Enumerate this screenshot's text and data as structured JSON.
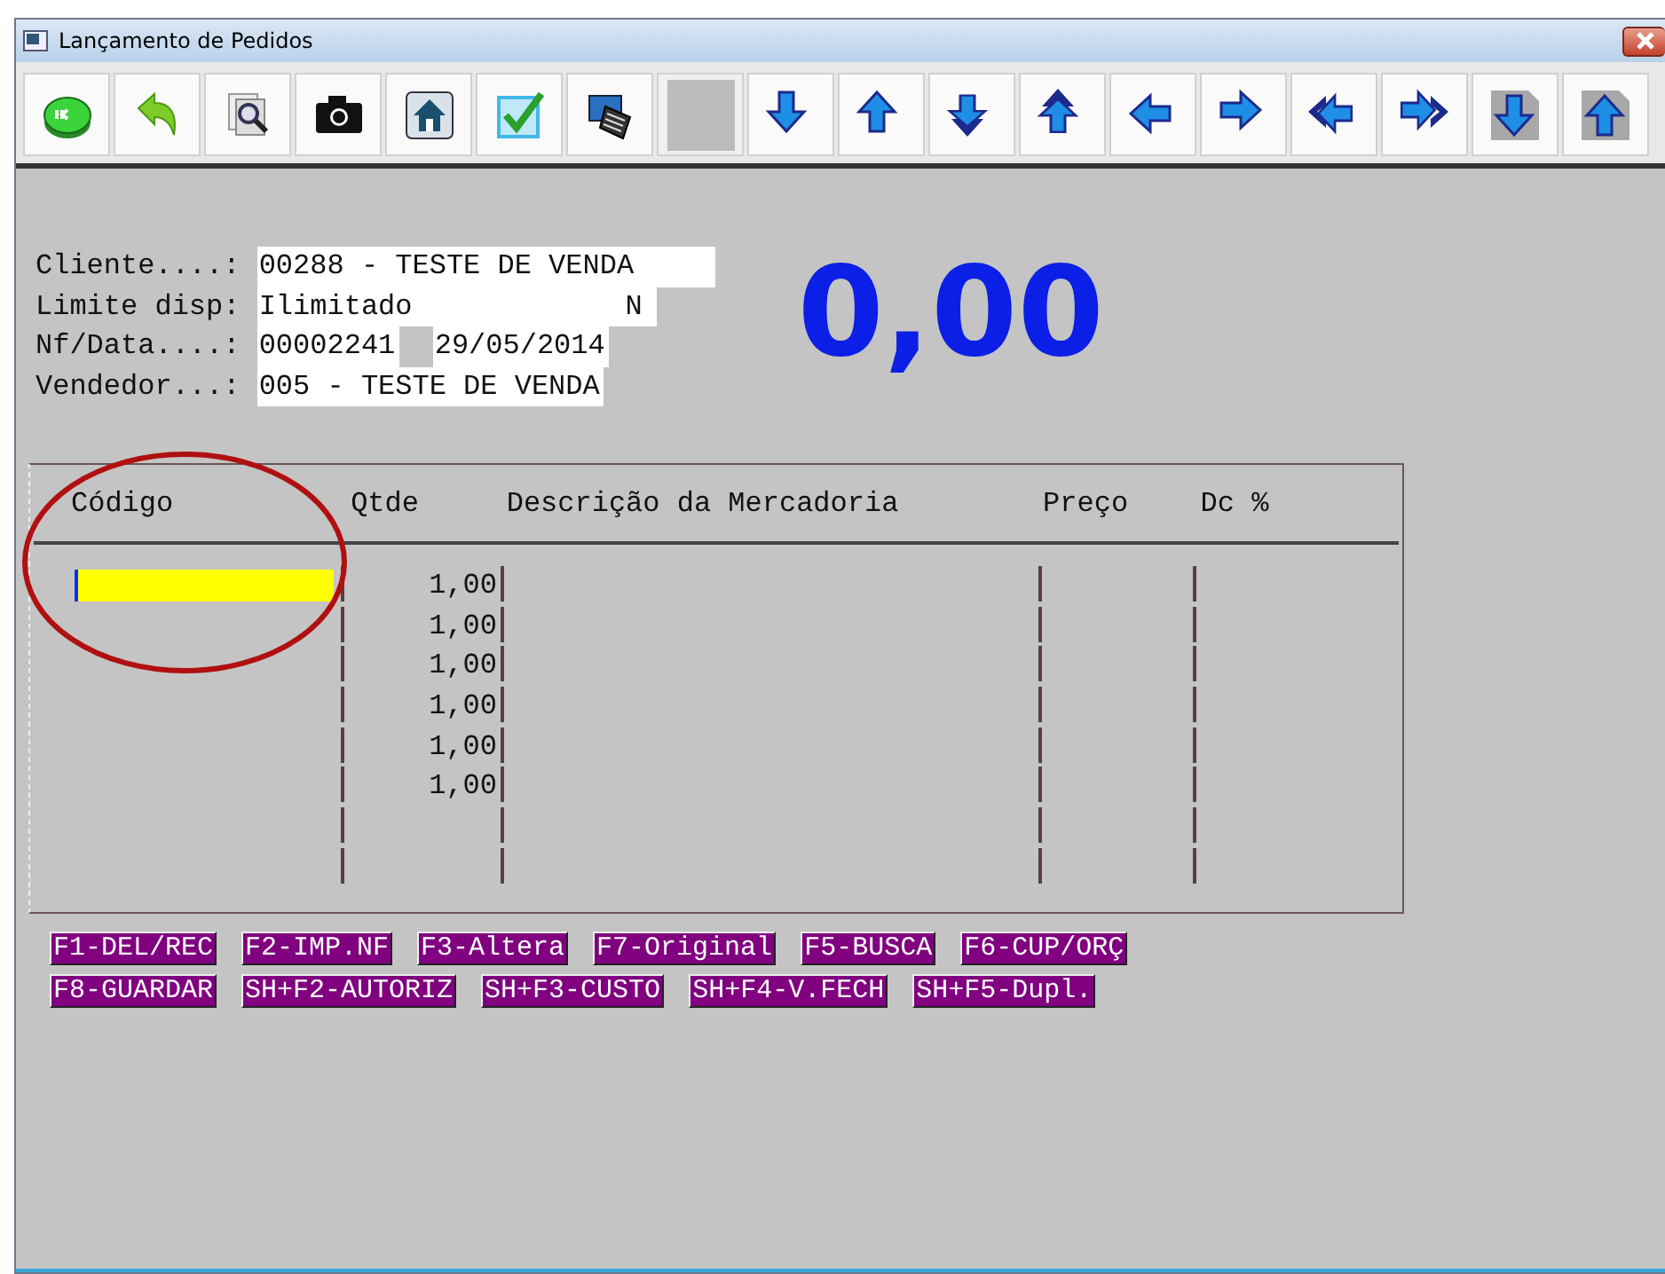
{
  "window": {
    "title": "Lançamento de Pedidos"
  },
  "toolbar": [
    {
      "kind": "ok"
    },
    {
      "kind": "undo"
    },
    {
      "kind": "search-docs"
    },
    {
      "kind": "camera"
    },
    {
      "kind": "home"
    },
    {
      "kind": "check"
    },
    {
      "kind": "tablet"
    },
    {
      "kind": "blank"
    },
    {
      "kind": "down"
    },
    {
      "kind": "up"
    },
    {
      "kind": "double-down"
    },
    {
      "kind": "double-up"
    },
    {
      "kind": "left"
    },
    {
      "kind": "right"
    },
    {
      "kind": "double-left"
    },
    {
      "kind": "double-right"
    },
    {
      "kind": "doc-down"
    },
    {
      "kind": "doc-up"
    }
  ],
  "fields": [
    {
      "label": "Cliente....:",
      "values": [
        "00288 - TESTE DE VENDA"
      ]
    },
    {
      "label": "Limite disp:",
      "values": [
        "Ilimitado",
        "N"
      ]
    },
    {
      "label": "Nf/Data....:",
      "values": [
        "00002241",
        "29/05/2014"
      ]
    },
    {
      "label": "Vendedor...:",
      "values": [
        "005 - TESTE DE VENDA"
      ]
    }
  ],
  "total": "0,00",
  "table": {
    "columns": [
      "Código",
      "Qtde",
      "Descrição da Mercadoria",
      "Preço",
      "Dc %"
    ],
    "rows": [
      {
        "active": true,
        "qtde": "1,00"
      },
      {
        "active": false,
        "qtde": "1,00"
      },
      {
        "active": false,
        "qtde": "1,00"
      },
      {
        "active": false,
        "qtde": "1,00"
      },
      {
        "active": false,
        "qtde": "1,00"
      },
      {
        "active": false,
        "qtde": "1,00"
      },
      {
        "active": false
      },
      {
        "active": false
      }
    ]
  },
  "function_keys": [
    [
      "F1-DEL/REC",
      "F2-IMP.NF",
      "F3-Altera",
      "F7-Original",
      "F5-BUSCA",
      "F6-CUP/ORÇ"
    ],
    [
      "F8-GUARDAR",
      "SH+F2-AUTORIZ",
      "SH+F3-CUSTO",
      "SH+F4-V.FECH",
      "SH+F5-Dupl."
    ]
  ]
}
